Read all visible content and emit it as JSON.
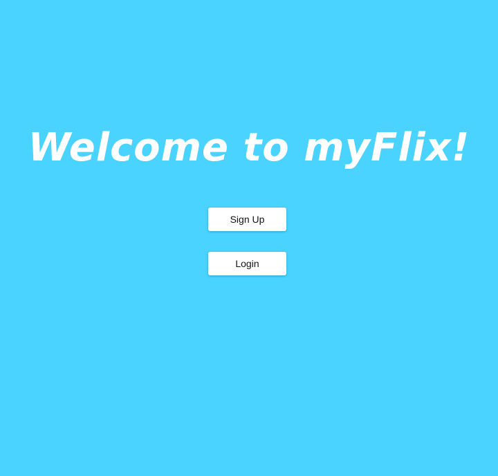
{
  "welcome": {
    "title": "Welcome to myFlix!"
  },
  "actions": {
    "signup_label": "Sign Up",
    "login_label": "Login"
  },
  "colors": {
    "background": "#4ad3ff",
    "title": "#ffffff",
    "button_bg": "#ffffff"
  }
}
